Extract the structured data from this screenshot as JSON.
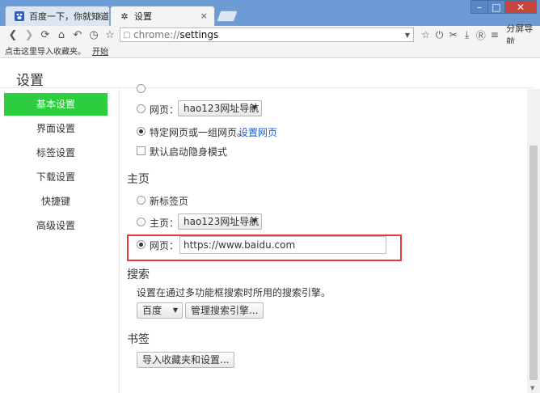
{
  "tabs": [
    {
      "title": "百度一下，你就知道",
      "close": "×"
    },
    {
      "title": "设置",
      "close": "×"
    }
  ],
  "window_controls": {
    "minimize": "–",
    "maximize": "□",
    "close": "✕"
  },
  "omnibox": {
    "prefix": "chrome://",
    "main": "settings"
  },
  "toolbar": {
    "split_label": "分屏导航"
  },
  "bookmarks": {
    "hint": "点击这里导入收藏夹。",
    "link": "开始"
  },
  "page": {
    "title": "设置"
  },
  "sidebar": {
    "items": [
      {
        "label": "基本设置",
        "active": true
      },
      {
        "label": "界面设置"
      },
      {
        "label": "标签设置"
      },
      {
        "label": "下载设置"
      },
      {
        "label": "快捷键"
      },
      {
        "label": "高级设置"
      }
    ]
  },
  "startup": {
    "opt_web_label": "网页：",
    "opt_web_select": "hao123网址导航",
    "opt_specific_label": "特定网页或一组网页。",
    "opt_specific_link": "设置网页",
    "incognito_label": "默认启动隐身模式"
  },
  "homepage": {
    "title": "主页",
    "newtab_label": "新标签页",
    "home_label": "主页：",
    "home_select": "hao123网址导航",
    "web_label": "网页：",
    "web_value": "https://www.baidu.com"
  },
  "search": {
    "title": "搜索",
    "description": "设置在通过多功能框搜索时所用的搜索引擎。",
    "engine": "百度",
    "manage_button": "管理搜索引擎..."
  },
  "bookmarks_section": {
    "title": "书签",
    "import_button": "导入收藏夹和设置..."
  },
  "colors": {
    "accent_green": "#2ccd3e",
    "highlight_red": "#e03c3c",
    "link_blue": "#1a5fd0"
  }
}
